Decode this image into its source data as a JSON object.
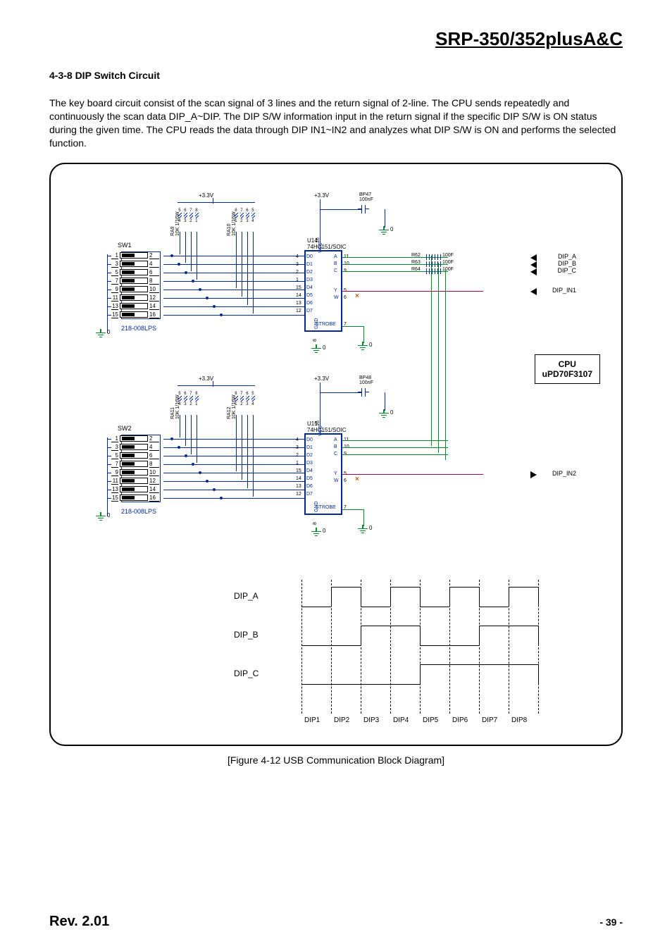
{
  "doc": {
    "title": "SRP-350/352plusA&C",
    "section_heading": "4-3-8 DIP Switch Circuit",
    "body": "The key board circuit consist of the scan signal of 3 lines and the return signal of 2-line. The CPU sends repeatedly and continuously the scan data DIP_A~DIP. The DIP S/W information input in the return signal if the specific DIP S/W is ON status during the given time. The CPU reads the data through DIP IN1~IN2 and analyzes what DIP S/W is ON and performs the selected function.",
    "figure_caption": "[Figure 4-12 USB Communication Block Diagram]",
    "footer_rev": "Rev. 2.01",
    "footer_page": "- 39 -"
  },
  "cpu": {
    "name": "CPU",
    "part": "uPD70F3107"
  },
  "outputs": {
    "dip_a": "DIP_A",
    "dip_b": "DIP_B",
    "dip_c": "DIP_C",
    "dip_in1": "DIP_IN1",
    "dip_in2": "DIP_IN2"
  },
  "blocks": [
    {
      "sw_name": "SW1",
      "sw_part": "218-008LPS",
      "rows": [
        {
          "l": "1",
          "r": "2"
        },
        {
          "l": "3",
          "r": "4"
        },
        {
          "l": "5",
          "r": "6"
        },
        {
          "l": "7",
          "r": "8"
        },
        {
          "l": "9",
          "r": "10"
        },
        {
          "l": "11",
          "r": "12"
        },
        {
          "l": "13",
          "r": "14"
        },
        {
          "l": "15",
          "r": "16"
        }
      ],
      "vcc": "+3.3V",
      "rn_left": {
        "ref": "RA9",
        "val": "10K 1/16W",
        "top": [
          "5",
          "6",
          "7",
          "8"
        ],
        "bot": [
          "4",
          "3",
          "2",
          "1"
        ]
      },
      "rn_right": {
        "ref": "RA10",
        "val": "10K 1/16W",
        "top": [
          "8",
          "7",
          "6",
          "5"
        ],
        "bot": [
          "1",
          "2",
          "3",
          "4"
        ]
      },
      "chip": {
        "ref": "U14",
        "part": "74HC151/SOIC",
        "vcc": "+3.3V",
        "d_pins": [
          {
            "n": "4",
            "t": "D0"
          },
          {
            "n": "3",
            "t": "D1"
          },
          {
            "n": "2",
            "t": "D2"
          },
          {
            "n": "1",
            "t": "D3"
          },
          {
            "n": "15",
            "t": "D4"
          },
          {
            "n": "14",
            "t": "D5"
          },
          {
            "n": "13",
            "t": "D6"
          },
          {
            "n": "12",
            "t": "D7"
          }
        ],
        "sel": [
          {
            "n": "11",
            "t": "A"
          },
          {
            "n": "10",
            "t": "B"
          },
          {
            "n": "9",
            "t": "C"
          }
        ],
        "yw": [
          {
            "n": "5",
            "t": "Y"
          },
          {
            "n": "6",
            "t": "W"
          }
        ],
        "strobe": {
          "n": "7",
          "t": "STROBE"
        },
        "gnd_pin": "8",
        "vcc_pin": "16"
      },
      "cap": {
        "ref": "BP47",
        "val": "100nF"
      },
      "res": [
        {
          "ref": "R62",
          "val": "100F"
        },
        {
          "ref": "R63",
          "val": "100F"
        },
        {
          "ref": "R64",
          "val": "100F"
        }
      ]
    },
    {
      "sw_name": "SW2",
      "sw_part": "218-008LPS",
      "rows": [
        {
          "l": "1",
          "r": "2"
        },
        {
          "l": "3",
          "r": "4"
        },
        {
          "l": "5",
          "r": "6"
        },
        {
          "l": "7",
          "r": "8"
        },
        {
          "l": "9",
          "r": "10"
        },
        {
          "l": "11",
          "r": "12"
        },
        {
          "l": "13",
          "r": "14"
        },
        {
          "l": "15",
          "r": "16"
        }
      ],
      "vcc": "+3.3V",
      "rn_left": {
        "ref": "RA11",
        "val": "10K 1/16W",
        "top": [
          "5",
          "6",
          "7",
          "8"
        ],
        "bot": [
          "4",
          "3",
          "2",
          "1"
        ]
      },
      "rn_right": {
        "ref": "RA12",
        "val": "10K 1/16W",
        "top": [
          "8",
          "7",
          "6",
          "5"
        ],
        "bot": [
          "1",
          "2",
          "3",
          "4"
        ]
      },
      "chip": {
        "ref": "U15",
        "part": "74HC151/SOIC",
        "vcc": "+3.3V",
        "d_pins": [
          {
            "n": "4",
            "t": "D0"
          },
          {
            "n": "3",
            "t": "D1"
          },
          {
            "n": "2",
            "t": "D2"
          },
          {
            "n": "1",
            "t": "D3"
          },
          {
            "n": "15",
            "t": "D4"
          },
          {
            "n": "14",
            "t": "D5"
          },
          {
            "n": "13",
            "t": "D6"
          },
          {
            "n": "12",
            "t": "D7"
          }
        ],
        "sel": [
          {
            "n": "11",
            "t": "A"
          },
          {
            "n": "10",
            "t": "B"
          },
          {
            "n": "9",
            "t": "C"
          }
        ],
        "yw": [
          {
            "n": "5",
            "t": "Y"
          },
          {
            "n": "6",
            "t": "W"
          }
        ],
        "strobe": {
          "n": "7",
          "t": "STROBE"
        },
        "gnd_pin": "8",
        "vcc_pin": "16"
      },
      "cap": {
        "ref": "BP48",
        "val": "100nF"
      }
    }
  ],
  "timing": {
    "rows": [
      "DIP_A",
      "DIP_B",
      "DIP_C"
    ],
    "cols": [
      "DIP1",
      "DIP2",
      "DIP3",
      "DIP4",
      "DIP5",
      "DIP6",
      "DIP7",
      "DIP8"
    ]
  },
  "gnd_label": "0"
}
